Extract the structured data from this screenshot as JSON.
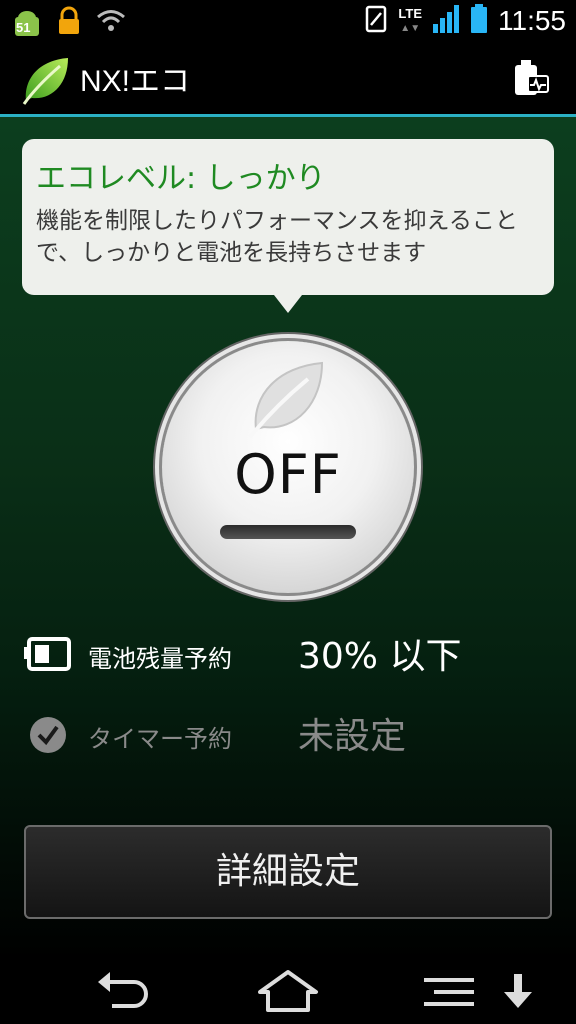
{
  "status_bar": {
    "notification_badge": "51",
    "network": "LTE",
    "time": "11:55",
    "icons": [
      "android-notification-icon",
      "lock-icon",
      "wifi-icon",
      "sim-icon",
      "signal-icon",
      "battery-icon"
    ]
  },
  "action_bar": {
    "title": "NX!エコ",
    "logo": "leaf-logo",
    "action_icon": "battery-monitor-icon"
  },
  "eco_bubble": {
    "title": "エコレベル: しっかり",
    "description": "機能を制限したりパフォーマンスを抑えることで、しっかりと電池を長持ちさせます"
  },
  "power_switch": {
    "label": "OFF",
    "state": "off"
  },
  "battery_reservation": {
    "label": "電池残量予約",
    "value": "30% 以下",
    "icon": "battery-level-icon"
  },
  "timer_reservation": {
    "label": "タイマー予約",
    "value": "未設定",
    "icon": "check-circle-icon"
  },
  "detail_button": {
    "label": "詳細設定"
  },
  "nav_bar": {
    "icons": [
      "back-icon",
      "home-icon",
      "menu-icon",
      "download-icon"
    ]
  },
  "colors": {
    "accent_line": "#2bb1c4",
    "bubble_title": "#1f8a22",
    "background_green": "#0c3e1e",
    "muted_text": "#8a8a8a"
  }
}
